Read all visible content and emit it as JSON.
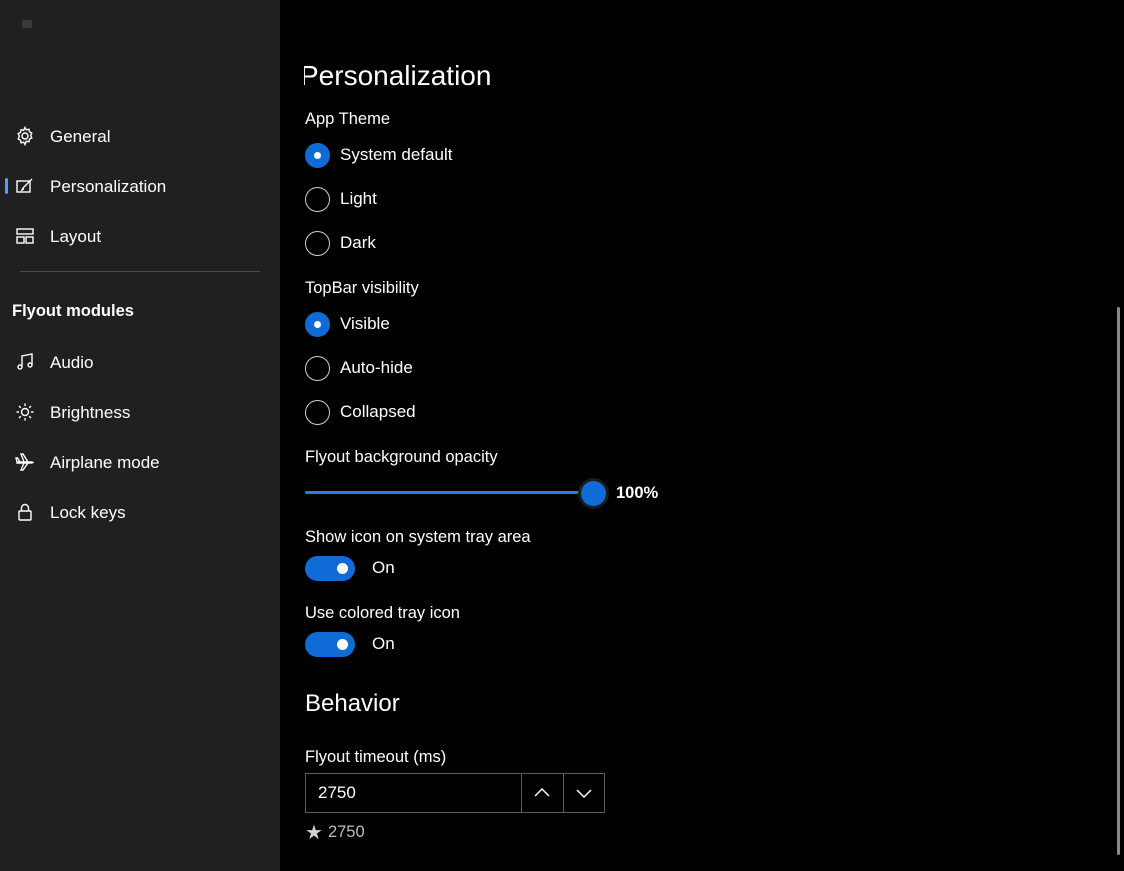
{
  "sidebar": {
    "items": [
      {
        "label": "General",
        "icon": "gear-icon",
        "selected": false
      },
      {
        "label": "Personalization",
        "icon": "personalize-icon",
        "selected": true
      },
      {
        "label": "Layout",
        "icon": "layout-icon",
        "selected": false
      }
    ],
    "section_heading": "Flyout modules",
    "modules": [
      {
        "label": "Audio",
        "icon": "music-icon"
      },
      {
        "label": "Brightness",
        "icon": "brightness-icon"
      },
      {
        "label": "Airplane mode",
        "icon": "airplane-icon"
      },
      {
        "label": "Lock keys",
        "icon": "lock-icon"
      }
    ]
  },
  "main": {
    "title": "Personalization",
    "app_theme": {
      "label": "App Theme",
      "options": [
        "System default",
        "Light",
        "Dark"
      ],
      "selected": "System default"
    },
    "topbar_visibility": {
      "label": "TopBar visibility",
      "options": [
        "Visible",
        "Auto-hide",
        "Collapsed"
      ],
      "selected": "Visible"
    },
    "opacity": {
      "label": "Flyout background opacity",
      "value_text": "100%",
      "value": 1.0
    },
    "tray_icon": {
      "label": "Show icon on system tray area",
      "state": "On"
    },
    "colored_tray": {
      "label": "Use colored tray icon",
      "state": "On"
    },
    "behavior": {
      "title": "Behavior",
      "timeout": {
        "label": "Flyout timeout (ms)",
        "value": "2750",
        "default_hint": "2750"
      }
    }
  },
  "colors": {
    "accent": "#0f6cd6",
    "sidebar_bg": "#202020",
    "main_bg": "#000000"
  }
}
